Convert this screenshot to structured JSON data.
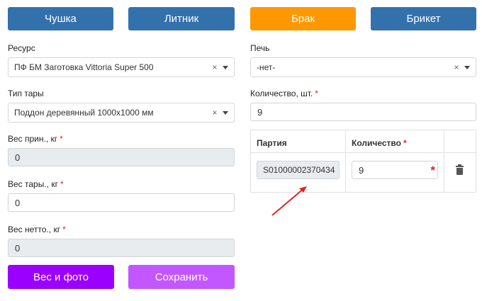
{
  "tabs": [
    {
      "label": "Чушка"
    },
    {
      "label": "Литник"
    },
    {
      "label": "Брак",
      "active": true
    },
    {
      "label": "Брикет"
    }
  ],
  "left": {
    "resource_label": "Ресурс",
    "resource_value": "ПФ БМ Заготовка Vittoria Super 500",
    "tare_type_label": "Тип тары",
    "tare_type_value": "Поддон деревянный 1000x1000 мм",
    "gross_weight_label": "Вес прин., кг",
    "gross_weight_value": "0",
    "tare_weight_label": "Вес тары., кг",
    "tare_weight_value": "0",
    "net_weight_label": "Вес нетто., кг",
    "net_weight_value": "0"
  },
  "right": {
    "furnace_label": "Печь",
    "furnace_value": "-нет-",
    "quantity_label": "Количество, шт.",
    "quantity_value": "9"
  },
  "table": {
    "headers": {
      "batch": "Партия",
      "quantity": "Количество"
    },
    "rows": [
      {
        "batch": "S01000002370434",
        "quantity": "9"
      }
    ]
  },
  "buttons": {
    "weight_photo": "Вес и фото",
    "save": "Сохранить"
  },
  "symbols": {
    "required": "*",
    "clear": "×"
  },
  "colors": {
    "tab_blue": "#3371ad",
    "tab_active": "#ff9800",
    "button_primary": "#9b00ff",
    "button_secondary": "#c257ff",
    "required": "#e02424",
    "arrow": "#e02424"
  }
}
